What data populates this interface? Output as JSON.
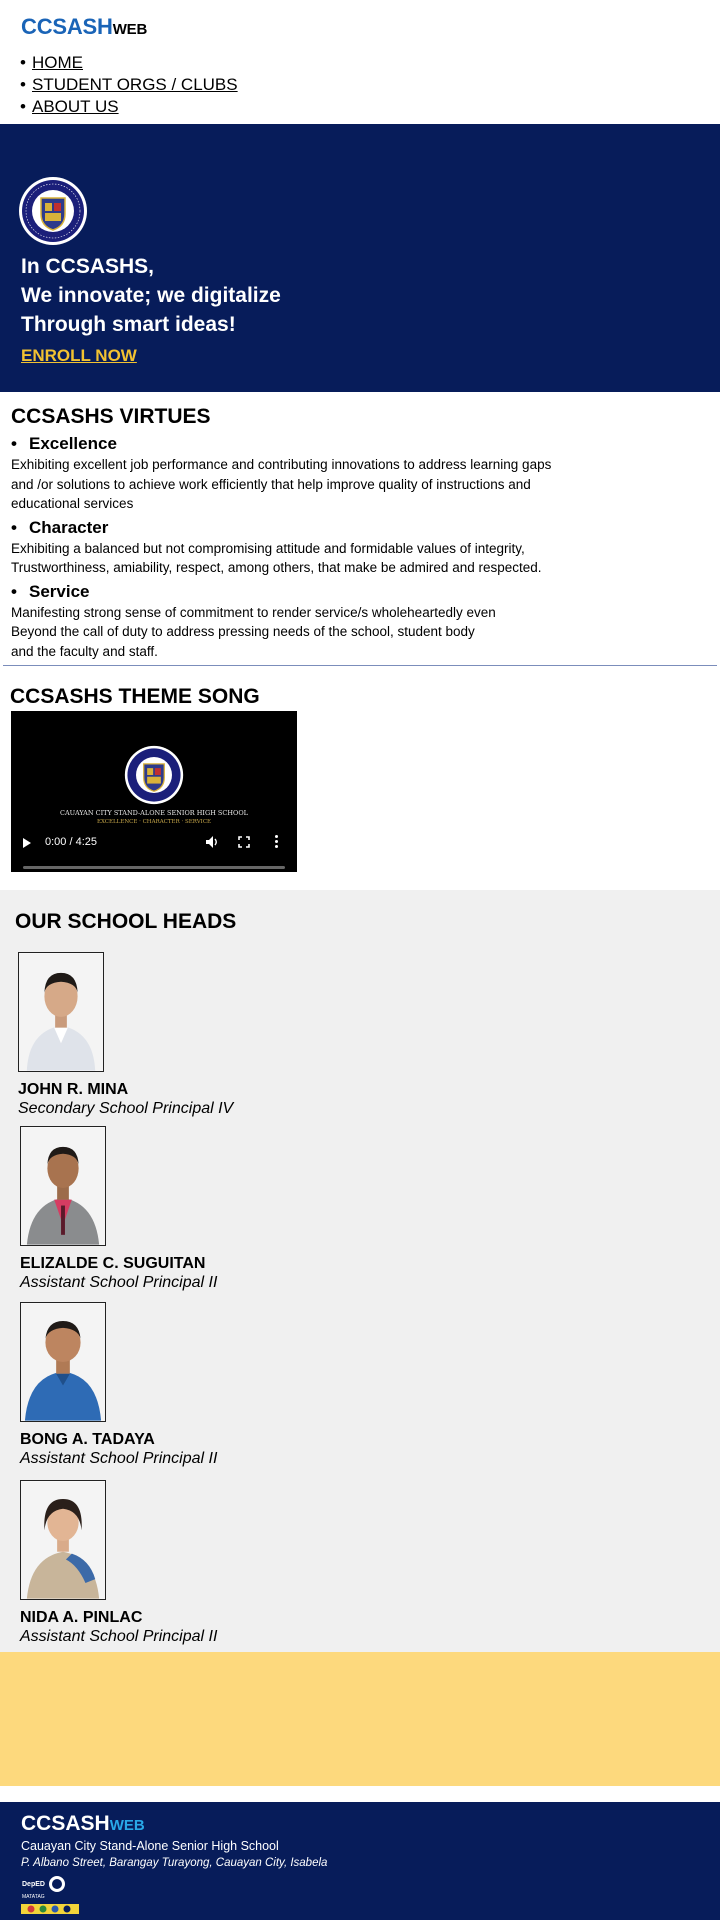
{
  "header": {
    "logo_main": "CCSASH",
    "logo_suffix": "WEB",
    "nav": [
      {
        "label": "HOME"
      },
      {
        "label": "STUDENT ORGS / CLUBS"
      },
      {
        "label": "ABOUT US"
      }
    ]
  },
  "hero": {
    "line1": "In CCSASHS,",
    "line2": "We innovate; we digitalize",
    "line3": "Through smart ideas!",
    "cta": "ENROLL NOW",
    "accent_color": "#f2c231",
    "background": "#071c5a"
  },
  "virtues": {
    "title": "CCSASHS VIRTUES",
    "items": [
      {
        "name": "Excellence",
        "desc": "Exhibiting excellent job performance  and contributing  innovations to  address learning gaps\nand /or solutions to achieve work efficiently that help improve quality of instructions and\neducational services"
      },
      {
        "name": "Character",
        "desc": "Exhibiting a balanced but not  compromising  attitude and formidable values of integrity,\nTrustworthiness,  amiability, respect, among others, that make be admired and respected."
      },
      {
        "name": "Service",
        "desc": "Manifesting strong sense of commitment  to render service/s wholeheartedly even\nBeyond the  call of duty to address pressing needs of the  school, student body\nand the faculty and staff."
      }
    ]
  },
  "song": {
    "title": "CCSASHS THEME SONG",
    "video_caption": "CAUAYAN CITY STAND-ALONE SENIOR HIGH SCHOOL",
    "video_subcaption": "EXCELLENCE · CHARACTER · SERVICE",
    "time": "0:00 / 4:25"
  },
  "heads": {
    "title": "OUR SCHOOL HEADS",
    "people": [
      {
        "name": "JOHN R.  MINA",
        "role": "Secondary School Principal IV"
      },
      {
        "name": "ELIZALDE C. SUGUITAN",
        "role": "Assistant School Principal II"
      },
      {
        "name": "BONG A. TADAYA",
        "role": "Assistant School Principal II"
      },
      {
        "name": "NIDA A. PINLAC",
        "role": "Assistant School Principal II"
      }
    ]
  },
  "footer": {
    "logo_main": "CCSASH",
    "logo_suffix": "WEB",
    "school": "Cauayan City Stand-Alone  Senior  High School",
    "address": "P. Albano Street,  Barangay Turayong, Cauayan City, Isabela",
    "suffix_color": "#29a9e8"
  },
  "icons": {
    "seal": "school-seal-icon",
    "play": "play-icon",
    "volume": "volume-icon",
    "fullscreen": "fullscreen-icon",
    "more": "more-options-icon",
    "badges": "deped-badges-icon"
  }
}
